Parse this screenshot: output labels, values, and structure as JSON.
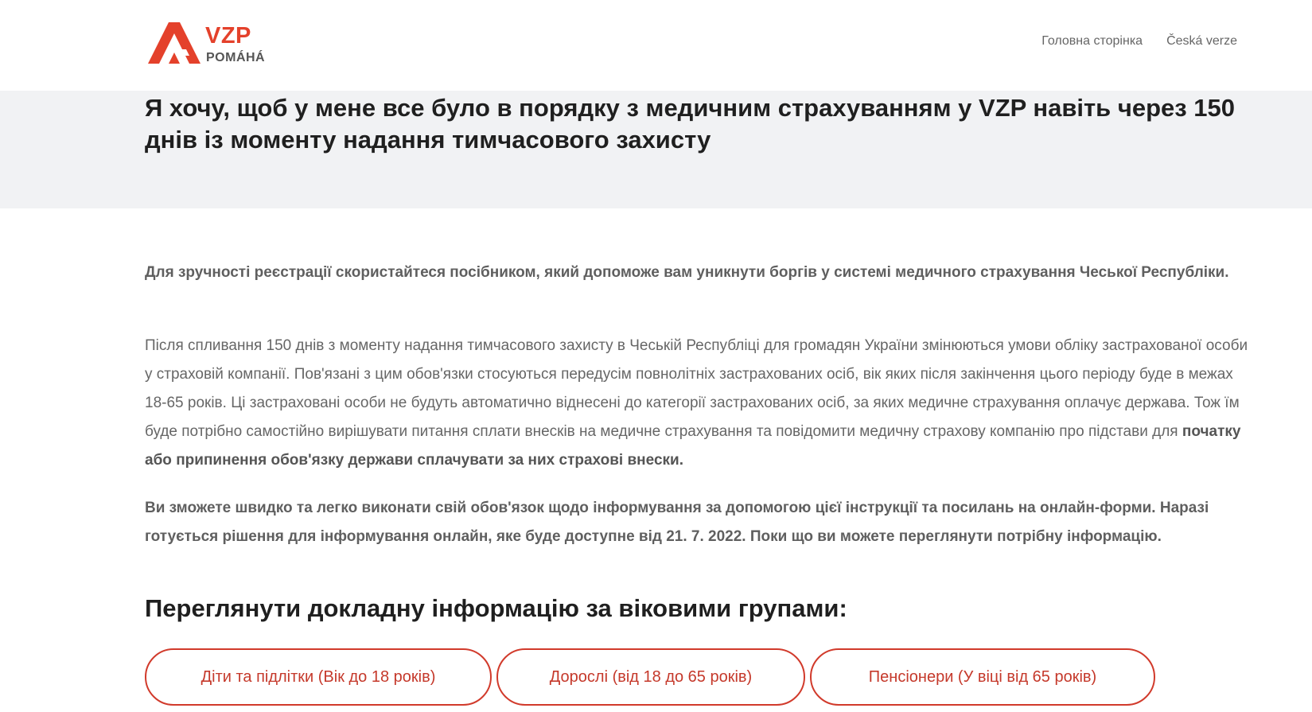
{
  "header": {
    "logo": {
      "brand": "VZP",
      "tagline": "POMÁHÁ",
      "icon": "vzp-logo-icon",
      "brand_color": "#e4412b"
    },
    "nav": [
      {
        "label": "Головна сторінка"
      },
      {
        "label": "Česká verze"
      }
    ]
  },
  "hero": {
    "title": "Я хочу, щоб у мене все було в порядку з медичним страхуванням у VZP навіть через 150 днів із моменту надання тимчасового захисту",
    "background": "#f1f2f4"
  },
  "content": {
    "intro_bold": "Для зручності реєстрації скористайтеся посібником, який допоможе вам уникнути боргів у системі медичного страхування Чеської Республіки.",
    "paragraph_main": "Після спливання 150 днів з моменту надання тимчасового захисту в Чеській Республіці для громадян України змінюються умови обліку застрахованої особи у страховій компанії.  Пов'язані з цим обов'язки стосуються передусім повнолітніх застрахованих осіб, вік яких після закінчення цього періоду буде в межах 18-65 років. Ці застраховані особи не будуть автоматично віднесені до категорії застрахованих осіб, за яких медичне страхування оплачує держава. Тож їм буде потрібно самостійно вирішувати питання сплати внесків на медичне страхування та повідомити медичну страхову компанію про підстави для",
    "paragraph_main_bold": "початку або припинення обов'язку держави сплачувати за них страхові внески.",
    "info_bold": "Ви зможете швидко та легко виконати свій обов'язок щодо інформування за допомогою цієї інструкції та посилань на онлайн-форми. Наразі готується рішення для інформування онлайн, яке буде доступне від 21. 7. 2022. Поки що ви можете переглянути потрібну інформацію.",
    "section_heading": "Переглянути докладну інформацію за віковими групами:"
  },
  "age_groups": [
    {
      "label": "Діти та підлітки (Вік до 18 років)"
    },
    {
      "label": "Дорослі (від 18 до 65 років)"
    },
    {
      "label": "Пенсіонери (У віці від 65 років)"
    }
  ],
  "colors": {
    "accent": "#d13a2b",
    "text": "#666666",
    "heading": "#1f1f1f"
  }
}
